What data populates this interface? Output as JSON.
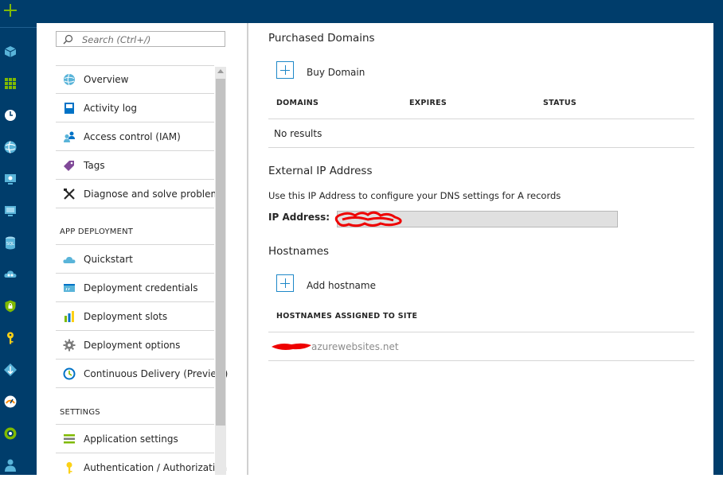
{
  "menu": {
    "search_placeholder": "Search (Ctrl+/)",
    "items": [
      {
        "label": "Overview"
      },
      {
        "label": "Activity log"
      },
      {
        "label": "Access control (IAM)"
      },
      {
        "label": "Tags"
      },
      {
        "label": "Diagnose and solve problems"
      }
    ],
    "app_deployment_header": "APP DEPLOYMENT",
    "deployment_items": [
      {
        "label": "Quickstart"
      },
      {
        "label": "Deployment credentials"
      },
      {
        "label": "Deployment slots"
      },
      {
        "label": "Deployment options"
      },
      {
        "label": "Continuous Delivery (Preview)"
      }
    ],
    "settings_header": "SETTINGS",
    "settings_items": [
      {
        "label": "Application settings"
      },
      {
        "label": "Authentication / Authorization"
      }
    ]
  },
  "domains": {
    "title": "Purchased Domains",
    "buy_label": "Buy Domain",
    "columns": [
      "DOMAINS",
      "EXPIRES",
      "STATUS"
    ],
    "empty_text": "No results"
  },
  "external_ip": {
    "title": "External IP Address",
    "description": "Use this IP Address to configure your DNS settings for A records",
    "label": "IP Address:"
  },
  "hostnames": {
    "title": "Hostnames",
    "add_label": "Add hostname",
    "column": "HOSTNAMES ASSIGNED TO SITE",
    "hostname_suffix": "azurewebsites.net"
  },
  "colors": {
    "navy": "#003d6b",
    "accent": "#1e88c8",
    "add_green": "#7fba00",
    "redaction": "#ee0000"
  },
  "rail_icons": [
    "create-resource-icon",
    "all-resources-icon",
    "dashboard-icon",
    "recent-icon",
    "app-services-icon",
    "virtual-machines-icon",
    "monitor-icon",
    "sql-database-icon",
    "cloud-services-icon",
    "security-center-icon",
    "key-vault-icon",
    "devops-icon",
    "advisor-icon",
    "circle-icon",
    "user-icon"
  ]
}
